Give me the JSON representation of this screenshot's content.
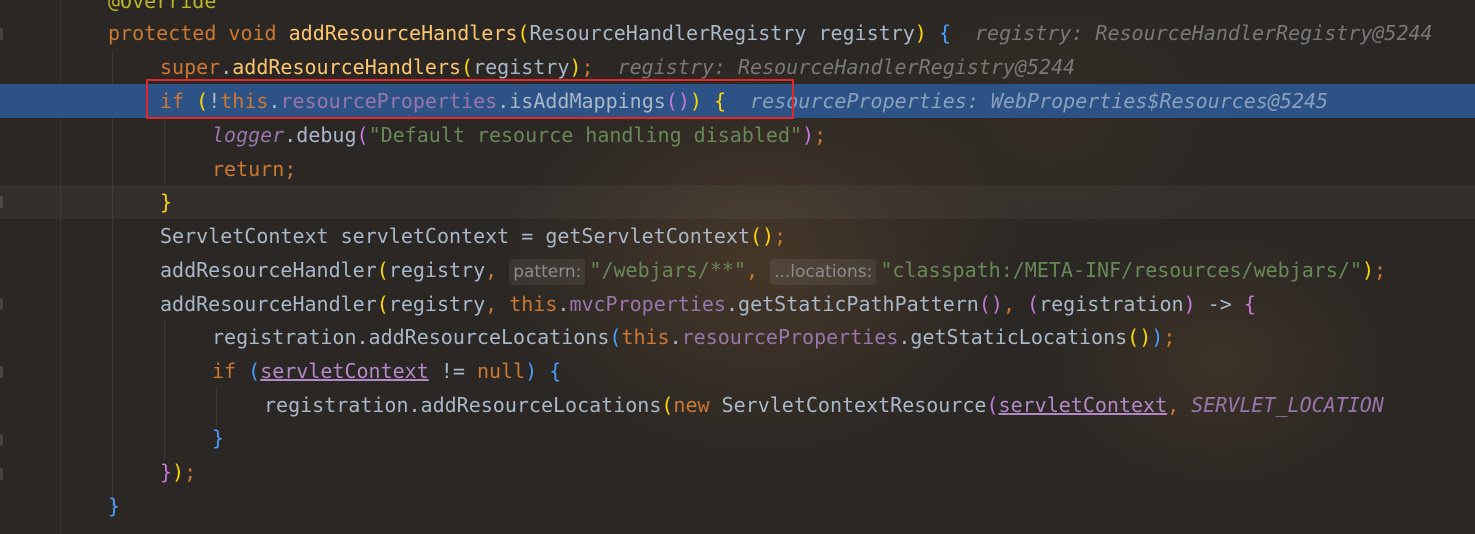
{
  "editor": {
    "lines": [
      {
        "segments": [
          {
            "t": "@Override",
            "c": "#bbb529"
          }
        ]
      },
      {
        "segments": [
          {
            "t": "protected",
            "c": "#cc7832"
          },
          {
            "t": " "
          },
          {
            "t": "void",
            "c": "#cc7832"
          },
          {
            "t": " "
          },
          {
            "t": "addResourceHandlers",
            "c": "#ffc66d"
          },
          {
            "t": "(",
            "c": "#ffd700"
          },
          {
            "t": "ResourceHandlerRegistry registry"
          },
          {
            "t": ")",
            "c": "#ffd700"
          },
          {
            "t": " "
          },
          {
            "t": "{",
            "c": "#4a9eff"
          },
          {
            "t": "  registry: ResourceHandlerRegistry@5244",
            "c": "#787878",
            "i": true
          }
        ]
      },
      {
        "segments": [
          {
            "t": "super",
            "c": "#cc7832"
          },
          {
            "t": "."
          },
          {
            "t": "addResourceHandlers",
            "c": "#ffc66d"
          },
          {
            "t": "(",
            "c": "#ffd700"
          },
          {
            "t": "registry"
          },
          {
            "t": ")",
            "c": "#ffd700"
          },
          {
            "t": ";",
            "c": "#cc7832"
          },
          {
            "t": "  registry: ResourceHandlerRegistry@5244",
            "c": "#787878",
            "i": true
          }
        ]
      },
      {
        "segments": [
          {
            "t": "if",
            "c": "#cc7832"
          },
          {
            "t": " "
          },
          {
            "t": "(",
            "c": "#ffd700"
          },
          {
            "t": "!"
          },
          {
            "t": "this",
            "c": "#cc7832"
          },
          {
            "t": "."
          },
          {
            "t": "resourceProperties",
            "c": "#9876aa"
          },
          {
            "t": "."
          },
          {
            "t": "isAddMappings"
          },
          {
            "t": "()",
            "c": "#c678dd"
          },
          {
            "t": ")",
            "c": "#ffd700"
          },
          {
            "t": " "
          },
          {
            "t": "{",
            "c": "#ffd700"
          },
          {
            "t": "  resourceProperties: WebProperties$Resources@5245",
            "c": "#8aa0bc",
            "i": true
          }
        ]
      },
      {
        "segments": [
          {
            "t": "logger",
            "c": "#9876aa",
            "i": true
          },
          {
            "t": "."
          },
          {
            "t": "debug"
          },
          {
            "t": "(",
            "c": "#c678dd"
          },
          {
            "t": "\"Default resource handling disabled\"",
            "c": "#6a8759"
          },
          {
            "t": ")",
            "c": "#c678dd"
          },
          {
            "t": ";",
            "c": "#cc7832"
          }
        ]
      },
      {
        "segments": [
          {
            "t": "return",
            "c": "#cc7832"
          },
          {
            "t": ";",
            "c": "#cc7832"
          }
        ]
      },
      {
        "segments": [
          {
            "t": "}",
            "c": "#ffd700"
          }
        ]
      },
      {
        "segments": [
          {
            "t": "ServletContext servletContext = "
          },
          {
            "t": "getServletContext"
          },
          {
            "t": "()",
            "c": "#ffd700"
          },
          {
            "t": ";",
            "c": "#cc7832"
          }
        ]
      },
      {
        "segments": [
          {
            "t": "addResourceHandler"
          },
          {
            "t": "(",
            "c": "#ffd700"
          },
          {
            "t": "registry"
          },
          {
            "t": ", ",
            "c": "#cc7832"
          },
          {
            "t": "pattern:",
            "hint": true
          },
          {
            "t": "\"/webjars/**\"",
            "c": "#6a8759"
          },
          {
            "t": ", ",
            "c": "#cc7832"
          },
          {
            "t": "...locations:",
            "hint": true
          },
          {
            "t": "\"classpath:/META-INF/resources/webjars/\"",
            "c": "#6a8759"
          },
          {
            "t": ")",
            "c": "#ffd700"
          },
          {
            "t": ";",
            "c": "#cc7832"
          }
        ]
      },
      {
        "segments": [
          {
            "t": "addResourceHandler"
          },
          {
            "t": "(",
            "c": "#ffd700"
          },
          {
            "t": "registry"
          },
          {
            "t": ", ",
            "c": "#cc7832"
          },
          {
            "t": "this",
            "c": "#cc7832"
          },
          {
            "t": "."
          },
          {
            "t": "mvcProperties",
            "c": "#9876aa"
          },
          {
            "t": "."
          },
          {
            "t": "getStaticPathPattern"
          },
          {
            "t": "()",
            "c": "#c678dd"
          },
          {
            "t": ", ",
            "c": "#cc7832"
          },
          {
            "t": "(",
            "c": "#c678dd"
          },
          {
            "t": "registration"
          },
          {
            "t": ")",
            "c": "#c678dd"
          },
          {
            "t": " -> "
          },
          {
            "t": "{",
            "c": "#c678dd"
          }
        ]
      },
      {
        "segments": [
          {
            "t": "registration.addResourceLocations"
          },
          {
            "t": "(",
            "c": "#4a9eff"
          },
          {
            "t": "this",
            "c": "#cc7832"
          },
          {
            "t": "."
          },
          {
            "t": "resourceProperties",
            "c": "#9876aa"
          },
          {
            "t": "."
          },
          {
            "t": "getStaticLocations"
          },
          {
            "t": "()",
            "c": "#ffd700"
          },
          {
            "t": ")",
            "c": "#4a9eff"
          },
          {
            "t": ";",
            "c": "#cc7832"
          }
        ]
      },
      {
        "segments": [
          {
            "t": "if",
            "c": "#cc7832"
          },
          {
            "t": " "
          },
          {
            "t": "(",
            "c": "#4a9eff"
          },
          {
            "t": "servletContext",
            "c": "#b389c5",
            "u": true
          },
          {
            "t": " != "
          },
          {
            "t": "null",
            "c": "#cc7832"
          },
          {
            "t": ")",
            "c": "#4a9eff"
          },
          {
            "t": " "
          },
          {
            "t": "{",
            "c": "#4a9eff"
          }
        ]
      },
      {
        "segments": [
          {
            "t": "registration.addResourceLocations"
          },
          {
            "t": "(",
            "c": "#ffd700"
          },
          {
            "t": "new",
            "c": "#cc7832"
          },
          {
            "t": " ServletContextResource"
          },
          {
            "t": "(",
            "c": "#c678dd"
          },
          {
            "t": "servletContext",
            "c": "#b389c5",
            "u": true
          },
          {
            "t": ", ",
            "c": "#cc7832"
          },
          {
            "t": "SERVLET_LOCATION",
            "c": "#9876aa",
            "i": true
          }
        ]
      },
      {
        "segments": [
          {
            "t": "}",
            "c": "#4a9eff"
          }
        ]
      },
      {
        "segments": [
          {
            "t": "}",
            "c": "#c678dd"
          },
          {
            "t": ")",
            "c": "#ffd700"
          },
          {
            "t": ";",
            "c": "#cc7832"
          }
        ]
      },
      {
        "segments": [
          {
            "t": "}",
            "c": "#4a9eff"
          }
        ]
      }
    ]
  }
}
